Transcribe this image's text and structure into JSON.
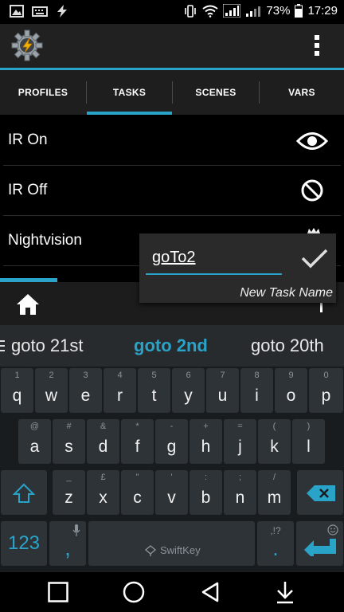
{
  "status": {
    "battery": "73%",
    "time": "17:29"
  },
  "appbar": {
    "menu_icon": "more-vert-icon",
    "logo_icon": "tasker-gear-icon"
  },
  "tabs": [
    {
      "label": "PROFILES"
    },
    {
      "label": "TASKS"
    },
    {
      "label": "SCENES"
    },
    {
      "label": "VARS"
    }
  ],
  "tasks": [
    {
      "label": "IR On",
      "icon": "eye-icon"
    },
    {
      "label": "IR Off",
      "icon": "no-icon"
    },
    {
      "label": "Nightvision",
      "icon": "scene-icon"
    }
  ],
  "popup": {
    "value": "goTo2",
    "hint": "New Task Name"
  },
  "suggestions": {
    "left": "goto 21st",
    "center": "goto 2nd",
    "right": "goto 20th"
  },
  "keyboard": {
    "row1": [
      {
        "main": "q",
        "sub": "1"
      },
      {
        "main": "w",
        "sub": "2"
      },
      {
        "main": "e",
        "sub": "3"
      },
      {
        "main": "r",
        "sub": "4"
      },
      {
        "main": "t",
        "sub": "5"
      },
      {
        "main": "y",
        "sub": "6"
      },
      {
        "main": "u",
        "sub": "7"
      },
      {
        "main": "i",
        "sub": "8"
      },
      {
        "main": "o",
        "sub": "9"
      },
      {
        "main": "p",
        "sub": "0"
      }
    ],
    "row2": [
      {
        "main": "a",
        "sub": "@"
      },
      {
        "main": "s",
        "sub": "#"
      },
      {
        "main": "d",
        "sub": "&"
      },
      {
        "main": "f",
        "sub": "*"
      },
      {
        "main": "g",
        "sub": "-"
      },
      {
        "main": "h",
        "sub": "+"
      },
      {
        "main": "j",
        "sub": "="
      },
      {
        "main": "k",
        "sub": "("
      },
      {
        "main": "l",
        "sub": ")"
      }
    ],
    "row3": [
      {
        "main": "z",
        "sub": "_"
      },
      {
        "main": "x",
        "sub": "£"
      },
      {
        "main": "c",
        "sub": "\""
      },
      {
        "main": "v",
        "sub": "'"
      },
      {
        "main": "b",
        "sub": ":"
      },
      {
        "main": "n",
        "sub": ";"
      },
      {
        "main": "m",
        "sub": "/"
      }
    ],
    "numbers_label": "123",
    "comma": ",",
    "period": ".",
    "punct_sub": ",!?",
    "space_brand": "SwiftKey"
  },
  "colors": {
    "accent": "#2aa3c8",
    "background": "#000000"
  }
}
